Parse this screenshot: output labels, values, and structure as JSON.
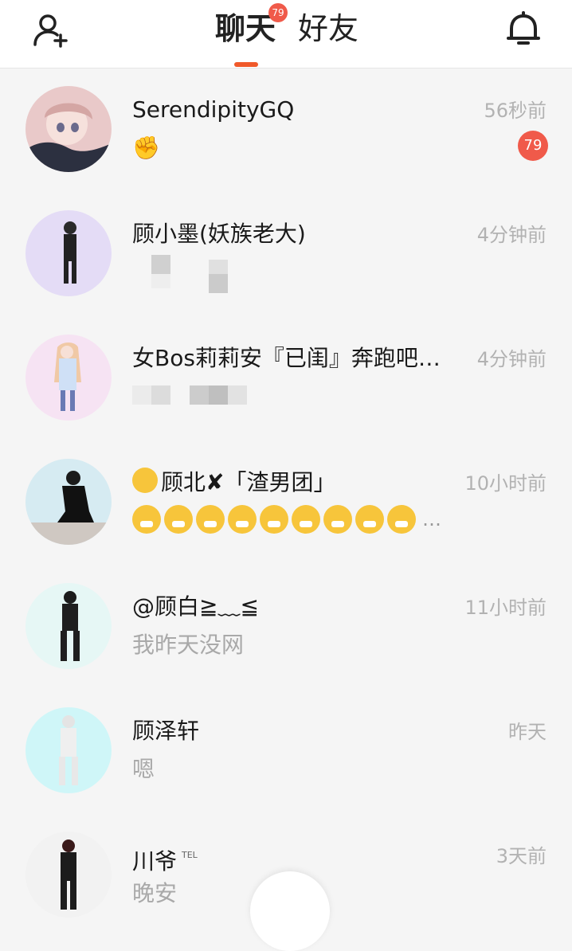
{
  "header": {
    "tabs": [
      {
        "label": "聊天",
        "badge": "79",
        "active": true
      },
      {
        "label": "好友",
        "active": false
      }
    ],
    "left_icon": "add-friend-icon",
    "right_icon": "bell-icon"
  },
  "chats": [
    {
      "name": "SerendipityGQ",
      "preview": "✊",
      "time": "56秒前",
      "unread": "79"
    },
    {
      "name": "顾小墨(妖族老大)",
      "preview": "",
      "time": "4分钟前"
    },
    {
      "name": "女Bos莉莉安『已闺』奔跑吧…",
      "preview": "",
      "time": "4分钟前"
    },
    {
      "name": "顾北✘「渣男团」",
      "preview": "…",
      "time": "10小时前"
    },
    {
      "name": "@顾白≧﹏≦",
      "preview": "我昨天没网",
      "time": "11小时前"
    },
    {
      "name": "顾泽轩",
      "preview": "嗯",
      "time": "昨天"
    },
    {
      "name": "川爷",
      "name_tag": "TEL",
      "preview": "晚安",
      "time": "3天前"
    }
  ],
  "colors": {
    "accent": "#f0592a",
    "badge": "#f05a4a",
    "time_text": "#b2b2b2",
    "preview_text": "#a9a9a9"
  }
}
